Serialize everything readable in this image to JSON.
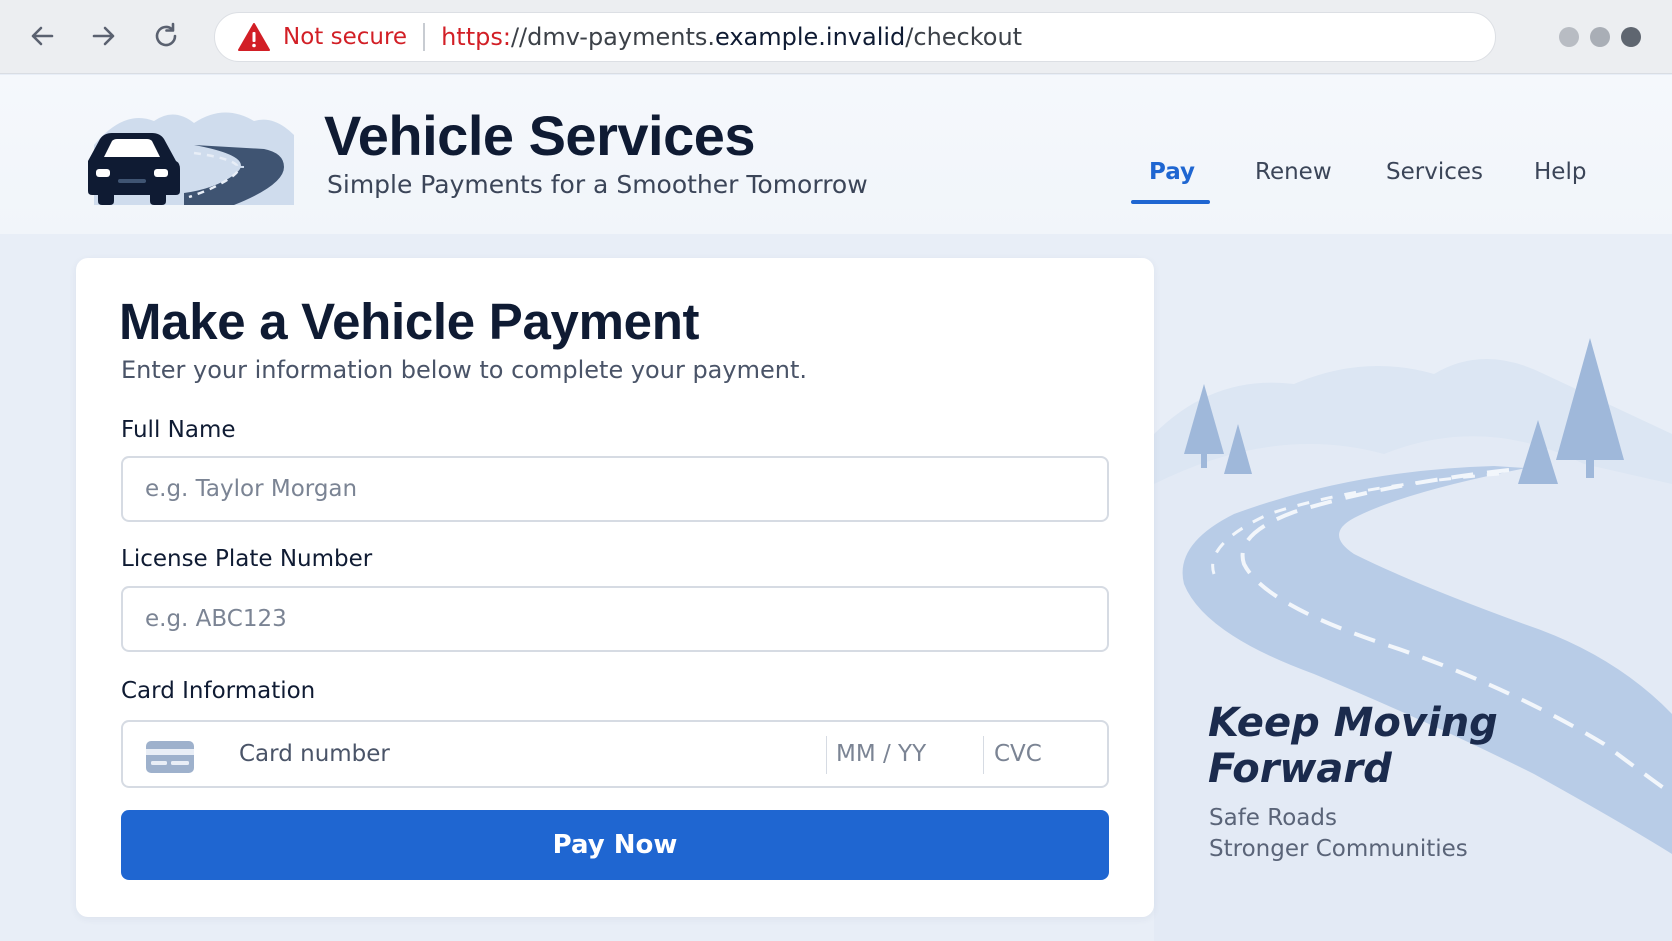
{
  "browser": {
    "security_label": "Not secure",
    "url_scheme": "https:",
    "url_path_start": "//dmv-payments.",
    "url_domain": "example.invalid",
    "url_path_end": "/checkout",
    "dot_colors": [
      "#b8bcc3",
      "#a9aeb6",
      "#5f6670"
    ]
  },
  "header": {
    "title": "Vehicle Services",
    "tagline": "Simple Payments for a Smoother Tomorrow",
    "nav": [
      {
        "label": "Pay",
        "active": true
      },
      {
        "label": "Renew",
        "active": false
      },
      {
        "label": "Services",
        "active": false
      },
      {
        "label": "Help",
        "active": false
      }
    ]
  },
  "form": {
    "title": "Make a Vehicle Payment",
    "subtitle": "Enter your information below to complete your payment.",
    "full_name": {
      "label": "Full Name",
      "placeholder": "e.g. Taylor Morgan",
      "value": ""
    },
    "plate": {
      "label": "License Plate Number",
      "placeholder": "e.g. ABC123",
      "value": ""
    },
    "card": {
      "label": "Card Information",
      "number_placeholder": "Card number",
      "expiry_placeholder": "MM / YY",
      "cvc_placeholder": "CVC"
    },
    "submit_label": "Pay Now"
  },
  "promo": {
    "title": "Keep Moving Forward",
    "line1": "Safe Roads",
    "line2": "Stronger Communities"
  },
  "colors": {
    "accent": "#1f66d1",
    "warning": "#d21f26",
    "heading": "#0f1b33",
    "page_background": "#e8eef7"
  },
  "icons": [
    "back-arrow-icon",
    "forward-arrow-icon",
    "reload-icon",
    "warning-triangle-icon",
    "car-logo-icon",
    "credit-card-icon"
  ]
}
